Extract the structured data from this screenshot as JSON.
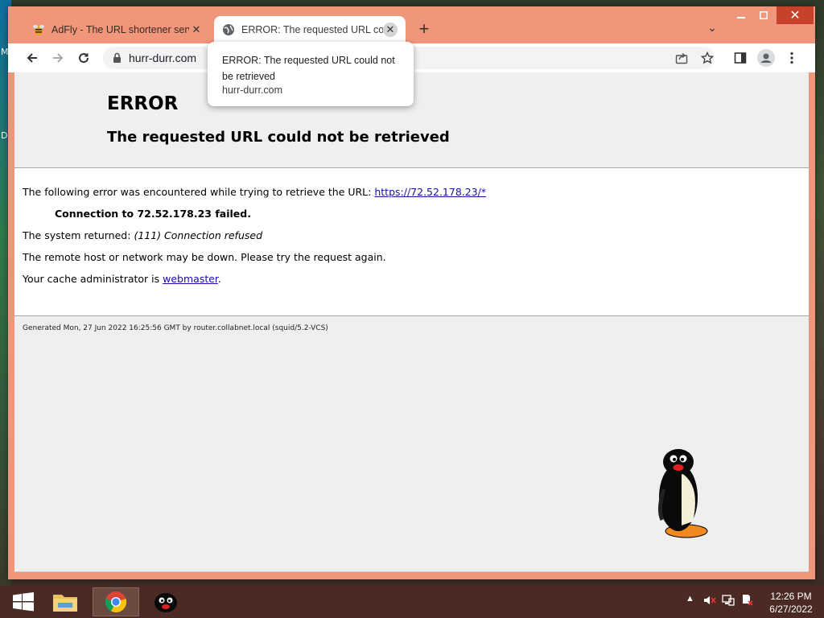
{
  "desktop": {
    "edge_labels": [
      "M",
      "D"
    ]
  },
  "browser": {
    "tabs": [
      {
        "title": "AdFly - The URL shortener servic",
        "icon": "adfly-favicon",
        "active": false
      },
      {
        "title": "ERROR: The requested URL could",
        "icon": "globe-icon",
        "active": true
      }
    ],
    "new_tab": "+",
    "omnibox": {
      "url": "hurr-durr.com"
    },
    "tooltip": {
      "title": "ERROR: The requested URL could not be retrieved",
      "url": "hurr-durr.com"
    }
  },
  "page": {
    "heading": "ERROR",
    "subheading": "The requested URL could not be retrieved",
    "line1_prefix": "The following error was encountered while trying to retrieve the URL:",
    "line1_link": "https://72.52.178.23/*",
    "error_detail": "Connection to 72.52.178.23 failed.",
    "system_prefix": "The system returned:",
    "system_value": "(111) Connection refused",
    "remote_msg": "The remote host or network may be down. Please try the request again.",
    "admin_prefix": "Your cache administrator is",
    "admin_link": "webmaster",
    "admin_suffix": ".",
    "footer": "Generated Mon, 27 Jun 2022 16:25:56 GMT by router.collabnet.local (squid/5.2-VCS)"
  },
  "taskbar": {
    "items": [
      "start-button",
      "file-explorer",
      "chrome",
      "pingu-app"
    ],
    "clock": {
      "time": "12:26 PM",
      "date": "6/27/2022"
    }
  },
  "colors": {
    "window_frame": "#f0967a",
    "close_button": "#c7402a",
    "link": "#1a0dab",
    "page_header_bg": "#efefef"
  }
}
